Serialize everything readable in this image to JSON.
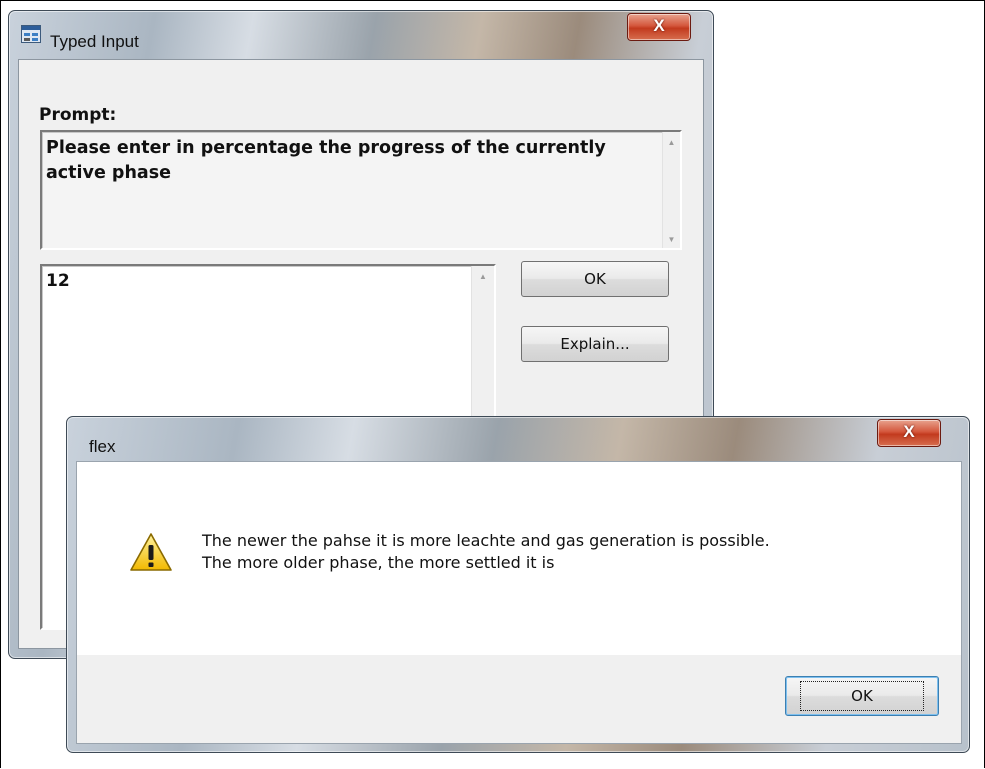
{
  "typed_input": {
    "title": "Typed Input",
    "close_label": "X",
    "prompt_label": "Prompt:",
    "prompt_text": "Please enter in percentage the progress of the currently active phase",
    "input_value": "12",
    "ok_label": "OK",
    "explain_label": "Explain..."
  },
  "flex_dialog": {
    "title": "flex",
    "close_label": "X",
    "message_line1": "The newer the pahse it is more leachte and gas generation is possible.",
    "message_line2": "The more older phase, the more settled it is",
    "ok_label": "OK"
  },
  "icons": {
    "app": "typed-input-app-icon",
    "warning": "warning-icon",
    "scroll_up": "scroll-up-arrow-icon",
    "scroll_down": "scroll-down-arrow-icon"
  }
}
